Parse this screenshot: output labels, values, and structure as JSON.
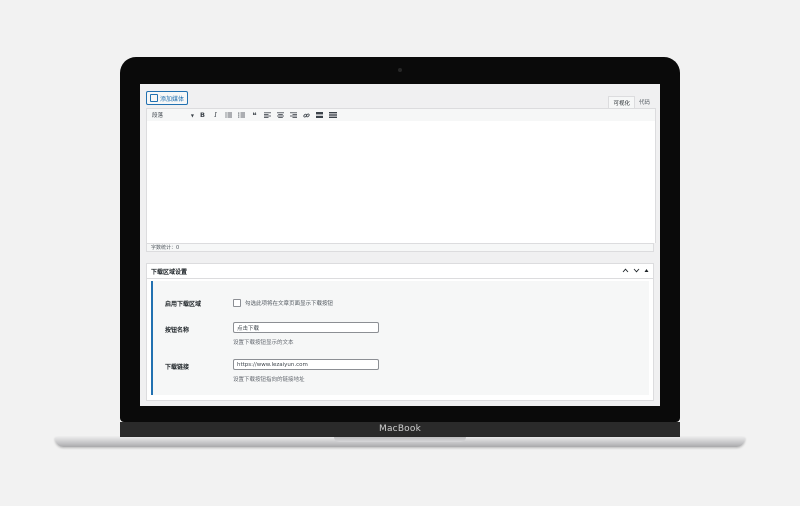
{
  "laptop": {
    "brand": "MacBook"
  },
  "editor": {
    "add_media_label": "添加媒体",
    "tabs": [
      {
        "label": "可视化",
        "active": true
      },
      {
        "label": "代码",
        "active": false
      }
    ],
    "format_select": "段落",
    "toolbar_icons": [
      "bold",
      "italic",
      "bullet-list",
      "numbered-list",
      "blockquote",
      "align-left",
      "align-center",
      "align-right",
      "link",
      "read-more",
      "toolbar-toggle"
    ],
    "toolbar_glyphs": {
      "bold": "B",
      "italic": "I",
      "blockquote": "❝"
    },
    "word_count": "字数统计：0"
  },
  "metabox": {
    "title": "下载区域设置",
    "rows": {
      "enable": {
        "label": "启用下载区域",
        "checkbox_desc": "勾选此项将在文章页面显示下载按钮",
        "checked": false
      },
      "button_name": {
        "label": "按钮名称",
        "value": "点击下载",
        "description": "设置下载按钮显示的文本"
      },
      "link": {
        "label": "下载链接",
        "value": "https://www.lezaiyun.com",
        "description": "设置下载按钮指向的链接地址"
      }
    }
  },
  "colors": {
    "accent": "#2271b1",
    "page_bg": "#f2f2f2",
    "bezel": "#0a0a0a"
  }
}
